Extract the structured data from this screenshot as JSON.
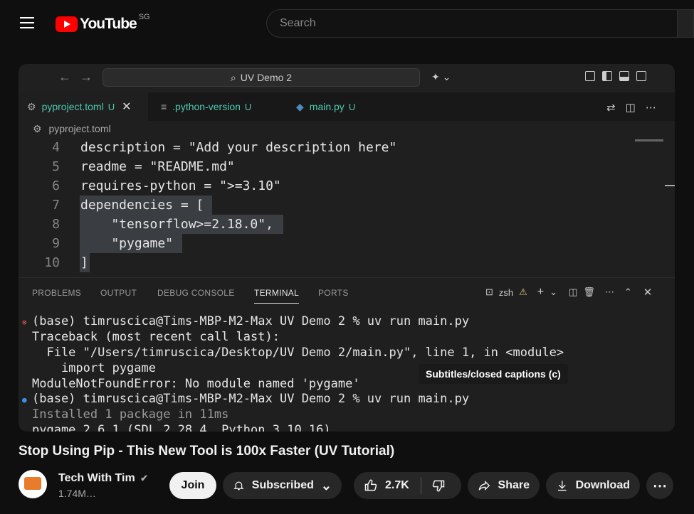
{
  "header": {
    "logo_text": "YouTube",
    "region": "SG",
    "search_placeholder": "Search"
  },
  "vscode": {
    "command_center": "UV Demo 2",
    "tabs": [
      {
        "label": "pyproject.toml",
        "status": "U"
      },
      {
        "label": ".python-version",
        "status": "U"
      },
      {
        "label": "main.py",
        "status": "U"
      }
    ],
    "breadcrumb": "pyproject.toml",
    "lines": [
      {
        "n": "4",
        "text": "description = \"Add your description here\""
      },
      {
        "n": "5",
        "text": "readme = \"README.md\""
      },
      {
        "n": "6",
        "text": "requires-python = \">=3.10\""
      },
      {
        "n": "7",
        "text": "dependencies = ["
      },
      {
        "n": "8",
        "text": "    \"tensorflow>=2.18.0\","
      },
      {
        "n": "9",
        "text": "    \"pygame\""
      },
      {
        "n": "10",
        "text": "]"
      }
    ],
    "panel_tabs": [
      "PROBLEMS",
      "OUTPUT",
      "DEBUG CONSOLE",
      "TERMINAL",
      "PORTS"
    ],
    "terminal_shell": "zsh",
    "terminal_lines": [
      "(base) timruscica@Tims-MBP-M2-Max UV Demo 2 % uv run main.py",
      "Traceback (most recent call last):",
      "  File \"/Users/timruscica/Desktop/UV Demo 2/main.py\", line 1, in <module>",
      "    import pygame",
      "ModuleNotFoundError: No module named 'pygame'",
      "(base) timruscica@Tims-MBP-M2-Max UV Demo 2 % uv run main.py",
      "Installed 1 package in 11ms",
      "pygame 2.6.1 (SDL 2.28.4, Python 3.10.16)"
    ],
    "tooltip": "Subtitles/closed captions (c)"
  },
  "video": {
    "title": "Stop Using Pip - This New Tool is 100x Faster (UV Tutorial)",
    "channel": "Tech With Tim",
    "subscribers": "1.74M…",
    "join_label": "Join",
    "subscribed_label": "Subscribed",
    "likes": "2.7K",
    "share_label": "Share",
    "download_label": "Download"
  },
  "colors": {
    "accent_red": "#ff0000",
    "terminal_green": "#4ec9b0"
  }
}
